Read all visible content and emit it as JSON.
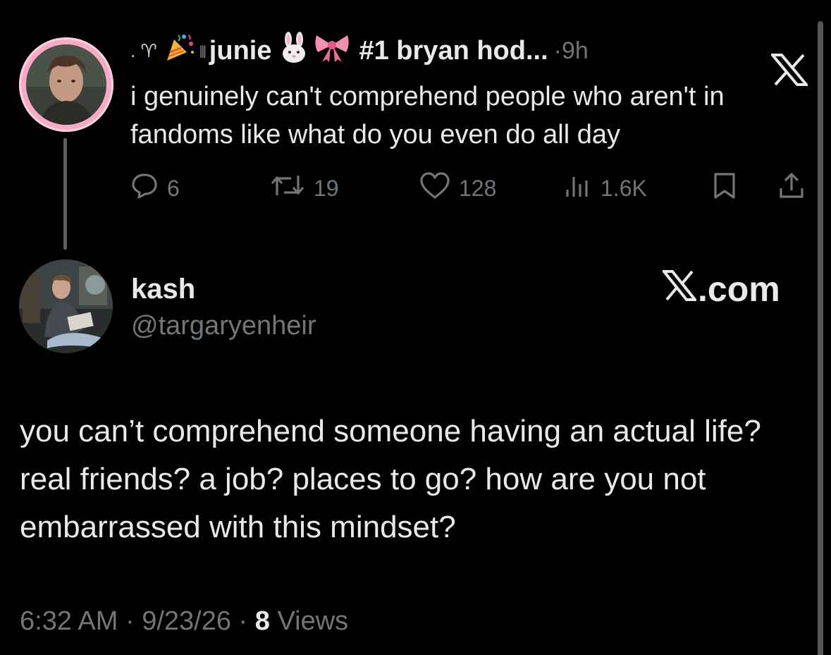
{
  "parent_tweet": {
    "name_prefix_symbols": ". ♈",
    "name_bars": "|||",
    "name_main": "junie",
    "name_suffix": "#1 bryan hod...",
    "time_sep": " · ",
    "time": "9h",
    "body": "i genuinely can't comprehend people who aren't in fandoms like what do you even do all day",
    "actions": {
      "replies": "6",
      "reposts": "19",
      "likes": "128",
      "views": "1.6K"
    },
    "icons": [
      "party-popper-icon",
      "rabbit-icon",
      "ribbon-bow-icon",
      "x-logo-icon",
      "reply-icon",
      "repost-icon",
      "like-icon",
      "views-icon",
      "bookmark-icon",
      "share-icon"
    ]
  },
  "reply_tweet": {
    "name": "kash",
    "handle": "@targaryenheir",
    "badge": ".com",
    "body": "you can’t comprehend someone having an actual life? real friends? a job? places to go? how are you not embarrassed with this mindset?",
    "meta": {
      "time": "6:32 AM",
      "sep1": " · ",
      "date": "9/23/26",
      "sep2": " · ",
      "views_count": "8",
      "views_label": " Views"
    }
  },
  "colors": {
    "background": "#000000",
    "primary_text": "#e7e9ea",
    "secondary_text": "#71767b",
    "avatar_ring": "#f7a9c8"
  }
}
